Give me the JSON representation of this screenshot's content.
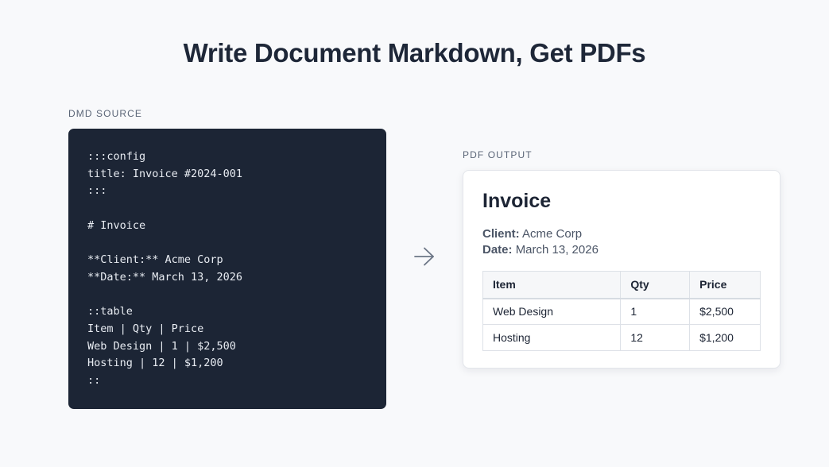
{
  "headline": "Write Document Markdown, Get PDFs",
  "source": {
    "label": "DMD SOURCE",
    "lines": [
      ":::config",
      "title: Invoice #2024-001",
      ":::",
      "",
      "# Invoice",
      "",
      "**Client:** Acme Corp",
      "**Date:** March 13, 2026",
      "",
      "::table",
      "Item | Qty | Price",
      "Web Design | 1 | $2,500",
      "Hosting | 12 | $1,200",
      "::"
    ]
  },
  "arrow_icon": "arrow-right-icon",
  "output": {
    "label": "PDF OUTPUT",
    "title": "Invoice",
    "client_key": "Client:",
    "client_value": "Acme Corp",
    "date_key": "Date:",
    "date_value": "March 13, 2026",
    "table": {
      "headers": [
        "Item",
        "Qty",
        "Price"
      ],
      "rows": [
        [
          "Web Design",
          "1",
          "$2,500"
        ],
        [
          "Hosting",
          "12",
          "$1,200"
        ]
      ]
    }
  },
  "colors": {
    "background": "#f8f9fb",
    "code_bg": "#1c2535",
    "code_text": "#e8ecf2",
    "heading": "#1e2738",
    "muted": "#5a6577"
  }
}
